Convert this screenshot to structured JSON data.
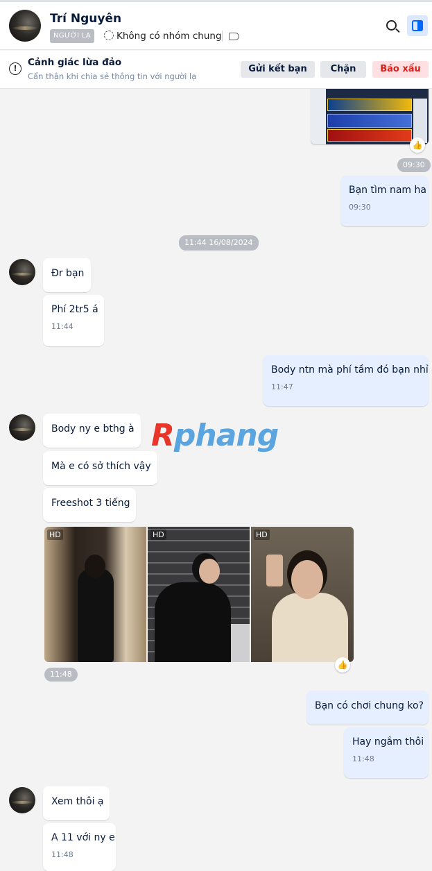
{
  "header": {
    "contact_name": "Trí Nguyên",
    "stranger_badge": "NGƯỜI LẠ",
    "group_status": "Không có nhóm chung",
    "icons": [
      "avatar",
      "group-icon",
      "tag-icon",
      "search-icon",
      "panel-toggle-icon"
    ]
  },
  "warning_bar": {
    "title": "Cảnh giác lừa đảo",
    "subtitle": "Cẩn thận khi chia sẻ thông tin với người lạ",
    "add_friend": "Gửi kết bạn",
    "block": "Chặn",
    "report": "Báo xấu",
    "report_color": "#dc1f18"
  },
  "watermark": {
    "r": "R",
    "rest": "phang"
  },
  "messages": {
    "img_time": "09:30",
    "out1": {
      "text": "Bạn tìm nam ha",
      "time": "09:30"
    },
    "date_divider": "11:44 16/08/2024",
    "in1": {
      "text": "Đr bạn"
    },
    "in2": {
      "text": "Phí 2tr5 á",
      "time": "11:44"
    },
    "out2": {
      "text": "Body ntn mà phí tầm đó bạn nhỉ",
      "time": "11:47"
    },
    "in3": {
      "text": "Body ny e bthg à"
    },
    "in4": {
      "text": "Mà e có sở thích vậy"
    },
    "in5": {
      "text": "Freeshot 3 tiếng"
    },
    "photos": {
      "hd_label": "HD",
      "time": "11:48"
    },
    "out3": {
      "text": "Bạn có chơi chung ko?"
    },
    "out4": {
      "text": "Hay ngắm thôi",
      "time": "11:48"
    },
    "in6": {
      "text": "Xem thôi ạ"
    },
    "in7": {
      "text": "A 11 với ny e",
      "time": "11:48"
    }
  },
  "colors": {
    "accent": "#0068ff",
    "out_bubble": "#e5efff",
    "background": "#f3f3f3"
  }
}
